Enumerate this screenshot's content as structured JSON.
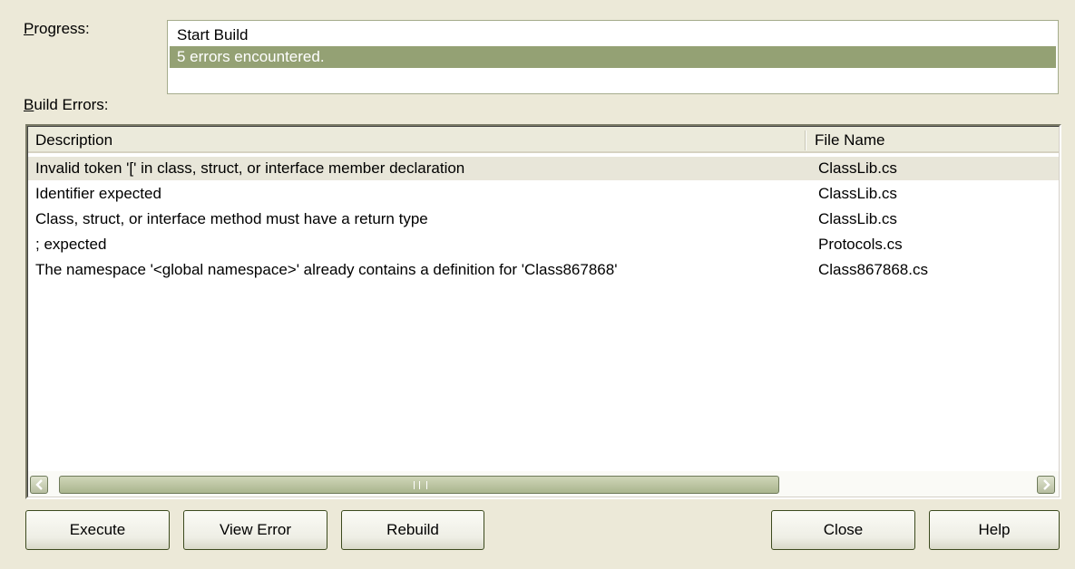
{
  "labels": {
    "progress_prefix": "P",
    "progress_rest": "rogress:",
    "build_errors_prefix": "B",
    "build_errors_rest": "uild Errors:"
  },
  "progress": {
    "lines": [
      "Start Build",
      "5 errors encountered."
    ],
    "selected_index": 1
  },
  "errors_list": {
    "columns": [
      "Description",
      "File Name"
    ],
    "rows": [
      {
        "description": "Invalid token '[' in class, struct, or interface member declaration",
        "file": "ClassLib.cs"
      },
      {
        "description": "Identifier expected",
        "file": "ClassLib.cs"
      },
      {
        "description": "Class, struct, or interface method must have a return type",
        "file": "ClassLib.cs"
      },
      {
        "description": "; expected",
        "file": "Protocols.cs"
      },
      {
        "description": "The namespace '<global namespace>' already contains a definition for 'Class867868'",
        "file": "Class867868.cs"
      }
    ]
  },
  "buttons": {
    "execute": "Execute",
    "view_error": "View Error",
    "rebuild": "Rebuild",
    "close": "Close",
    "help": "Help"
  },
  "icons": {
    "scroll_left": "arrow-left-icon",
    "scroll_right": "arrow-right-icon"
  },
  "colors": {
    "dialog_bg": "#ece9d8",
    "selection": "#94a174"
  }
}
